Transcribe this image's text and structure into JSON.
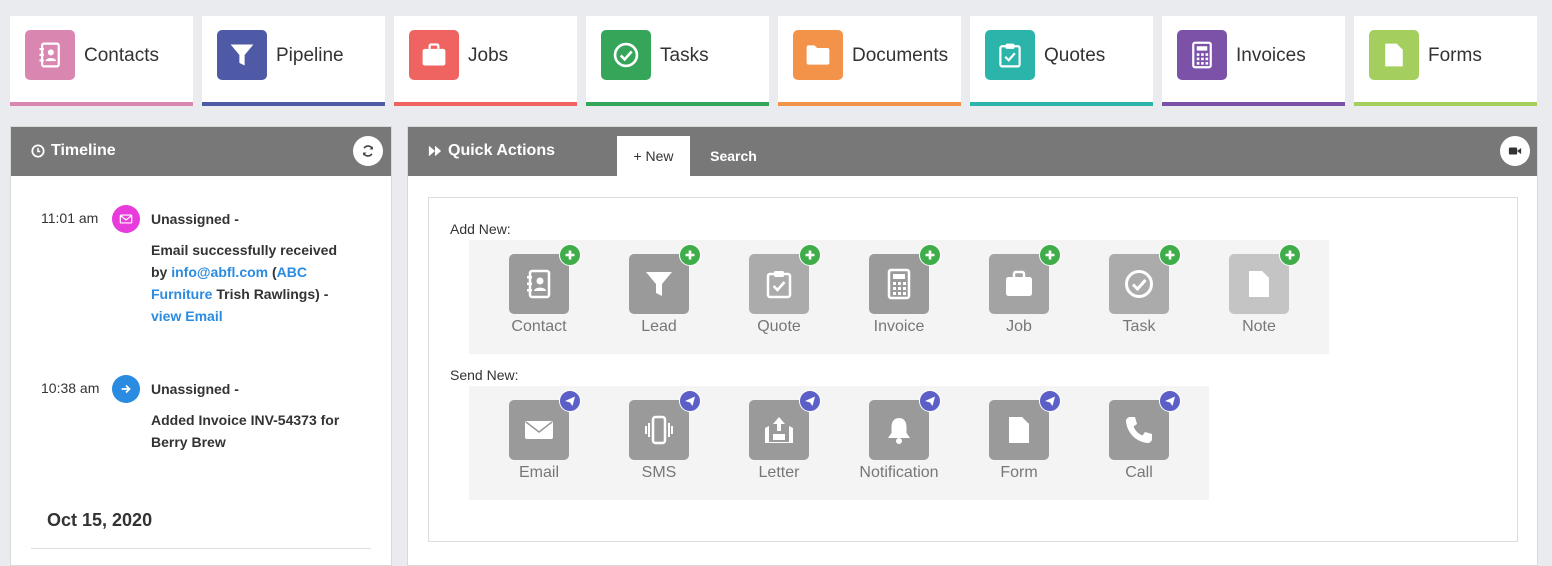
{
  "nav": [
    {
      "label": "Contacts",
      "color": "#d986b0",
      "icon": "address-book-icon"
    },
    {
      "label": "Pipeline",
      "color": "#4e5aa6",
      "icon": "funnel-icon"
    },
    {
      "label": "Jobs",
      "color": "#ef6461",
      "icon": "briefcase-icon"
    },
    {
      "label": "Tasks",
      "color": "#35a559",
      "icon": "check-circle-icon"
    },
    {
      "label": "Documents",
      "color": "#f39249",
      "icon": "folder-icon"
    },
    {
      "label": "Quotes",
      "color": "#2bb5aa",
      "icon": "clipboard-check-icon"
    },
    {
      "label": "Invoices",
      "color": "#7b52a8",
      "icon": "calculator-icon"
    },
    {
      "label": "Forms",
      "color": "#a4cf5f",
      "icon": "file-icon"
    }
  ],
  "timeline": {
    "title": "Timeline",
    "entries": [
      {
        "time": "11:01 am",
        "who": "Unassigned -",
        "badge_color": "#e83bdc",
        "icon": "envelope-icon",
        "text_1": "Email successfully received",
        "text_2": "by ",
        "email": "info@abfl.com",
        "text_3": " (",
        "company": "ABC Furniture",
        "text_4": " Trish Rawlings) -",
        "link": "view Email"
      },
      {
        "time": "10:38 am",
        "who": "Unassigned -",
        "badge_color": "#2a8be0",
        "icon": "arrow-right-icon",
        "text": "Added Invoice INV-54373 for Berry Brew"
      }
    ],
    "date": "Oct 15, 2020"
  },
  "quick": {
    "title": "Quick Actions",
    "tabs": {
      "new": "+ New",
      "search": "Search"
    },
    "add_label": "Add New:",
    "send_label": "Send New:",
    "add_items": [
      {
        "label": "Contact",
        "icon": "address-book-icon",
        "color": "#9a9a9a"
      },
      {
        "label": "Lead",
        "icon": "funnel-icon",
        "color": "#9a9a9a"
      },
      {
        "label": "Quote",
        "icon": "clipboard-check-icon",
        "color": "#ababab"
      },
      {
        "label": "Invoice",
        "icon": "calculator-icon",
        "color": "#9a9a9a"
      },
      {
        "label": "Job",
        "icon": "briefcase-icon",
        "color": "#a3a3a3"
      },
      {
        "label": "Task",
        "icon": "check-circle-icon",
        "color": "#ababab"
      },
      {
        "label": "Note",
        "icon": "file-icon",
        "color": "#c4c4c4"
      }
    ],
    "send_items": [
      {
        "label": "Email",
        "icon": "envelope-icon",
        "color": "#9a9a9a"
      },
      {
        "label": "SMS",
        "icon": "phone-vibrate-icon",
        "color": "#9a9a9a"
      },
      {
        "label": "Letter",
        "icon": "inbox-upload-icon",
        "color": "#9a9a9a"
      },
      {
        "label": "Notification",
        "icon": "bell-icon",
        "color": "#9a9a9a"
      },
      {
        "label": "Form",
        "icon": "file-icon",
        "color": "#9a9a9a"
      },
      {
        "label": "Call",
        "icon": "phone-icon",
        "color": "#9a9a9a"
      }
    ],
    "add_badge_color": "#3fae4a",
    "send_badge_color": "#5b5fc7"
  }
}
